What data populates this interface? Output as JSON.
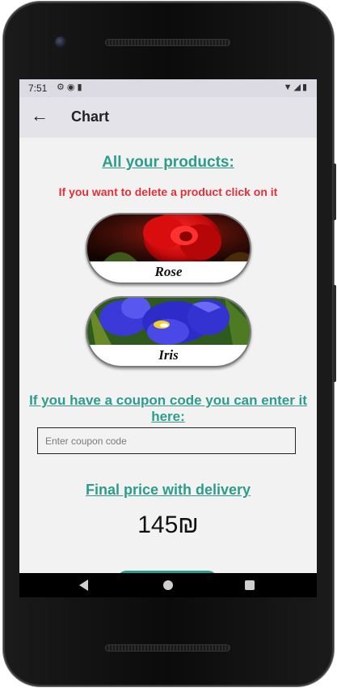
{
  "status_bar": {
    "time": "7:51",
    "left_icons": [
      "gear-icon",
      "android-icon",
      "sim-card-icon"
    ],
    "right_icons": [
      "wifi-icon",
      "signal-icon",
      "battery-icon"
    ]
  },
  "app_bar": {
    "back_icon": "arrow-left-icon",
    "title": "Chart"
  },
  "content": {
    "products_heading": "All your products:",
    "delete_hint": "If you want to delete a product click on it",
    "products": [
      {
        "name": "Rose",
        "image": "red-rose-photo"
      },
      {
        "name": "Iris",
        "image": "blue-iris-photo"
      }
    ],
    "coupon_heading": "If you have a coupon code you can enter it here:",
    "coupon_placeholder": "Enter coupon code",
    "final_heading": "Final price with delivery",
    "final_price": "145₪"
  },
  "nav_bar": {
    "buttons": [
      "back-triangle-icon",
      "home-circle-icon",
      "recents-square-icon"
    ]
  },
  "colors": {
    "accent": "#2e9c8a",
    "warning": "#e0303a",
    "app_bar": "#e5e3ea",
    "background": "#f2f2f2"
  }
}
